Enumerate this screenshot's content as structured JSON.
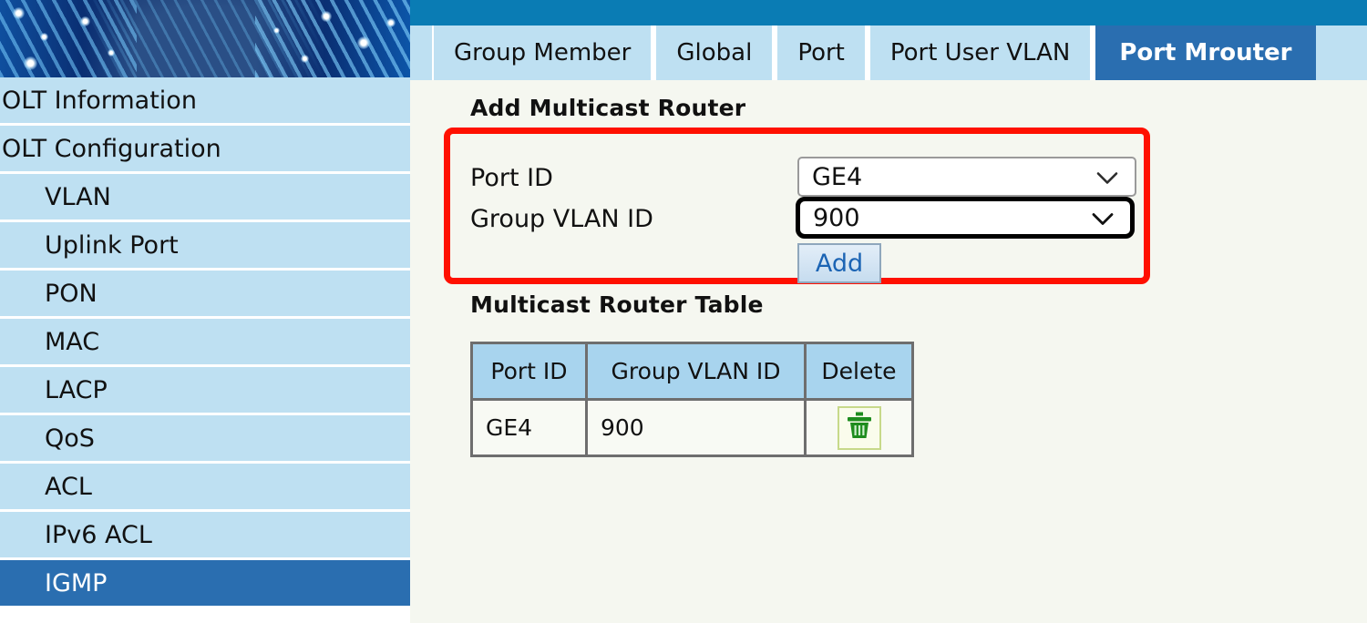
{
  "theme": {
    "topbar_color": "#0A7CB4",
    "sidebar_item_bg": "#BEE0F2",
    "active_blue": "#2A6EB0",
    "content_bg": "#F5F7F0",
    "highlight_red": "#FF1000",
    "table_header_bg": "#A8D4EE",
    "add_button_text": "#1B64B4",
    "cursor_color": "#AEE832"
  },
  "sidebar": {
    "banner_icon": "globe-banner-image",
    "items": [
      {
        "label": "OLT Information",
        "level": "top",
        "active": false
      },
      {
        "label": "OLT Configuration",
        "level": "top",
        "active": false
      },
      {
        "label": "VLAN",
        "level": "sub",
        "active": false
      },
      {
        "label": "Uplink Port",
        "level": "sub",
        "active": false
      },
      {
        "label": "PON",
        "level": "sub",
        "active": false
      },
      {
        "label": "MAC",
        "level": "sub",
        "active": false
      },
      {
        "label": "LACP",
        "level": "sub",
        "active": false
      },
      {
        "label": "QoS",
        "level": "sub",
        "active": false
      },
      {
        "label": "ACL",
        "level": "sub",
        "active": false
      },
      {
        "label": "IPv6 ACL",
        "level": "sub",
        "active": false
      },
      {
        "label": "IGMP",
        "level": "sub",
        "active": true
      }
    ]
  },
  "tabs": [
    {
      "label": "Group Member",
      "active": false
    },
    {
      "label": "Global",
      "active": false
    },
    {
      "label": "Port",
      "active": false
    },
    {
      "label": "Port User VLAN",
      "active": false
    },
    {
      "label": "Port Mrouter",
      "active": true
    }
  ],
  "add_section": {
    "title": "Add Multicast Router",
    "port_id": {
      "label": "Port ID",
      "value": "GE4",
      "icon": "chevron-down-icon",
      "focused": false
    },
    "group_vlan_id": {
      "label": "Group VLAN ID",
      "value": "900",
      "icon": "chevron-down-icon",
      "focused": true
    },
    "add_button_label": "Add"
  },
  "table_section": {
    "title": "Multicast Router Table",
    "columns": [
      "Port ID",
      "Group VLAN ID",
      "Delete"
    ],
    "rows": [
      {
        "port_id": "GE4",
        "group_vlan_id": "900",
        "delete_icon": "trash-icon"
      }
    ]
  },
  "cursor": {
    "icon": "mouse-pointer-icon"
  }
}
